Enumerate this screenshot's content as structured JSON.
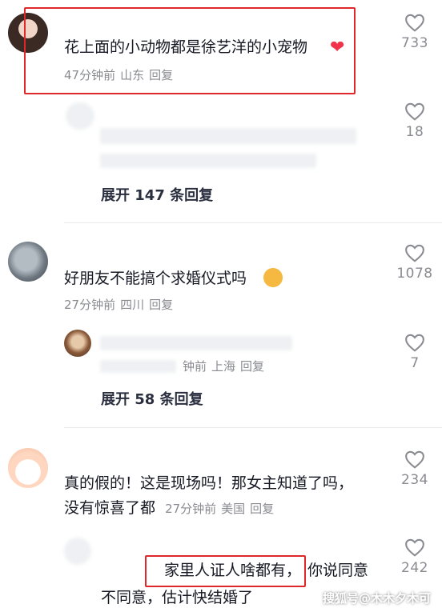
{
  "comments": [
    {
      "text": "花上面的小动物都是徐艺洋的小宠物",
      "time": "47分钟前",
      "location": "山东",
      "reply": "回复",
      "likes": "733"
    },
    {
      "time": "27分钟前",
      "location": "四川",
      "reply": "回复",
      "likes": "1078",
      "text": "好朋友不能搞个求婚仪式吗"
    },
    {
      "text_line1": "真的假的！这是现场吗！那女主知道了吗，",
      "text_line2": "没有惊喜了都",
      "time": "27分钟前",
      "location": "美国",
      "reply": "回复",
      "likes": "234"
    }
  ],
  "replies": [
    {
      "likes": "18",
      "expand": "展开 147 条回复"
    },
    {
      "time": "钟前",
      "location": "上海",
      "reply": "回复",
      "likes": "7",
      "expand": "展开 58 条回复"
    },
    {
      "likes": "242",
      "text_highlight": "家里人证人啥都有，",
      "text_rest": "你说同意",
      "text_line2": "不同意，估计快结婚了"
    }
  ],
  "watermark": "搜狐号@木木夕木可",
  "colors": {
    "highlight_box": "#e0282c",
    "heart": "#8a8b91"
  }
}
